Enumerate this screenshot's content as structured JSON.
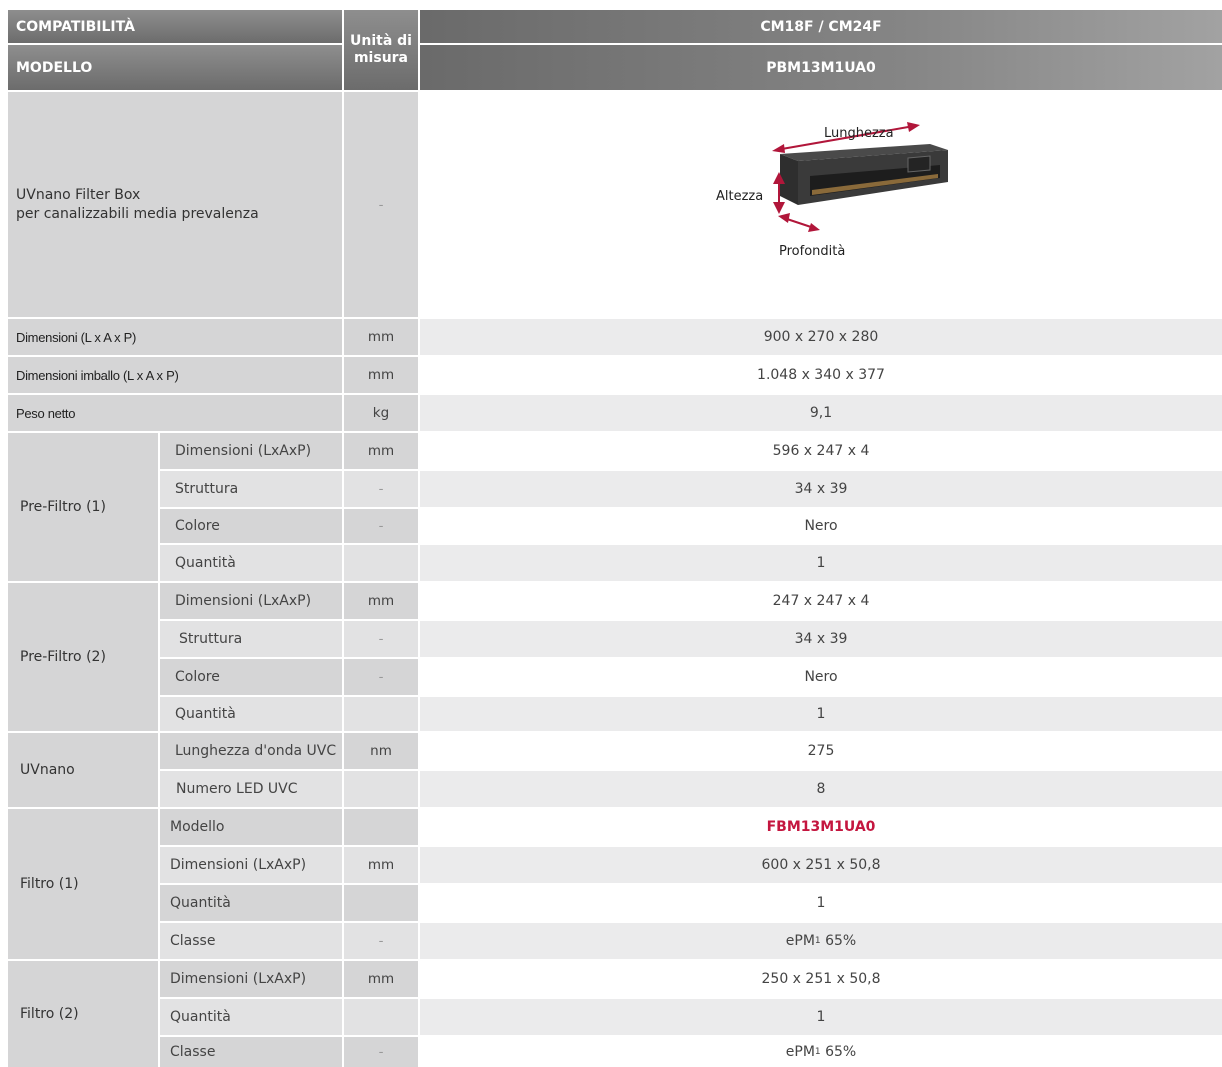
{
  "header": {
    "compat_label": "COMPATIBILITÀ",
    "unit_label": "Unità di misura",
    "compat_value": "CM18F / CM24F",
    "model_label": "MODELLO",
    "model_value": "PBM13M1UA0"
  },
  "product": {
    "name_line1": "UVnano Filter Box",
    "name_line2": "per canalizzabili media prevalenza",
    "unit": "-",
    "image_labels": {
      "length": "Lunghezza",
      "height": "Altezza",
      "depth": "Profondità"
    }
  },
  "rows": {
    "dim": {
      "label": "Dimensioni (L x A x P)",
      "unit": "mm",
      "value": "900 x 270 x 280"
    },
    "pack": {
      "label": "Dimensioni imballo (L x A x P)",
      "unit": "mm",
      "value": "1.048 x 340 x 377"
    },
    "weight": {
      "label": "Peso netto",
      "unit": "kg",
      "value": "9,1"
    }
  },
  "prefilter1": {
    "group": "Pre-Filtro (1)",
    "rows": [
      {
        "label": "Dimensioni (LxAxP)",
        "unit": "mm",
        "value": "596 x 247 x 4"
      },
      {
        "label": "Struttura",
        "unit": "-",
        "value": "34 x 39"
      },
      {
        "label": "Colore",
        "unit": "-",
        "value": "Nero"
      },
      {
        "label": "Quantità",
        "unit": "",
        "value": "1"
      }
    ]
  },
  "prefilter2": {
    "group": "Pre-Filtro (2)",
    "rows": [
      {
        "label": "Dimensioni (LxAxP)",
        "unit": "mm",
        "value": "247 x 247 x 4"
      },
      {
        "label": "Struttura",
        "unit": "-",
        "value": "34 x 39"
      },
      {
        "label": "Colore",
        "unit": "-",
        "value": "Nero"
      },
      {
        "label": "Quantità",
        "unit": "",
        "value": "1"
      }
    ]
  },
  "uvnano": {
    "group": "UVnano",
    "rows": [
      {
        "label": "Lunghezza d'onda UVC",
        "unit": "nm",
        "value": "275"
      },
      {
        "label": "Numero LED UVC",
        "unit": "",
        "value": "8"
      }
    ]
  },
  "filter1": {
    "group": "Filtro (1)",
    "rows": [
      {
        "label": "Modello",
        "unit": "",
        "value": "FBM13M1UA0"
      },
      {
        "label": "Dimensioni (LxAxP)",
        "unit": "mm",
        "value": "600 x 251 x 50,8"
      },
      {
        "label": "Quantità",
        "unit": "",
        "value": "1"
      },
      {
        "label": "Classe",
        "unit": "-",
        "value_main": "ePM",
        "value_sub": "1",
        "value_rest": " 65%"
      }
    ]
  },
  "filter2": {
    "group": "Filtro (2)",
    "rows": [
      {
        "label": "Dimensioni (LxAxP)",
        "unit": "mm",
        "value": "250 x 251 x 50,8"
      },
      {
        "label": "Quantità",
        "unit": "",
        "value": "1"
      },
      {
        "label": "Classe",
        "unit": "-",
        "value_main": "ePM",
        "value_sub": "1",
        "value_rest": " 65%"
      }
    ]
  },
  "colors": {
    "left_bg": "#d5d5d6",
    "value_alt_bg": "#ebebec",
    "accent": "#c4163f"
  }
}
